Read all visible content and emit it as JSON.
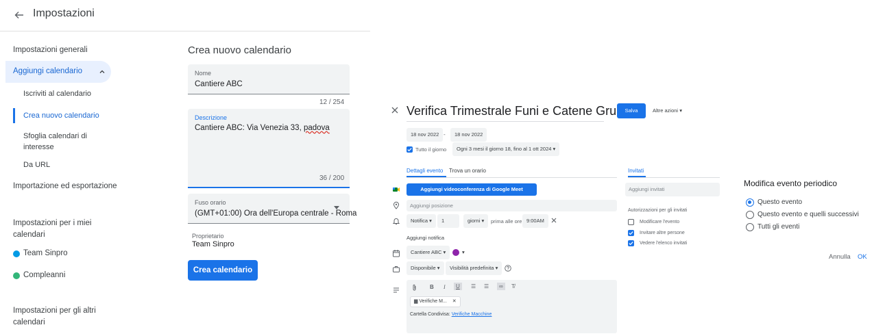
{
  "settings": {
    "back_icon": "arrow-left-icon",
    "title": "Impostazioni",
    "nav": {
      "general": "Impostazioni generali",
      "add_calendar": "Aggiungi calendario",
      "subscribe": "Iscriviti al calendario",
      "create_new": "Crea nuovo calendario",
      "browse_line1": "Sfoglia calendari di",
      "browse_line2": "interesse",
      "from_url": "Da URL",
      "import_export": "Importazione ed esportazione",
      "my_calendars_line1": "Impostazioni per i miei",
      "my_calendars_line2": "calendari",
      "calendars": [
        {
          "name": "Team Sinpro",
          "color": "#039be5"
        },
        {
          "name": "Compleanni",
          "color": "#33b679"
        }
      ],
      "other_calendars_line1": "Impostazioni per gli altri",
      "other_calendars_line2": "calendari"
    }
  },
  "form": {
    "title": "Crea nuovo calendario",
    "name_label": "Nome",
    "name_value": "Cantiere ABC",
    "name_counter": "12 / 254",
    "description_label": "Descrizione",
    "description_value_main": "Cantiere ABC: Via Venezia 33, ",
    "description_value_misspelled": "padova",
    "description_counter": "36 / 200",
    "timezone_label": "Fuso orario",
    "timezone_value": "(GMT+01:00) Ora dell'Europa centrale - Roma",
    "owner_label": "Proprietario",
    "owner_value": "Team Sinpro",
    "create_button": "Crea calendario",
    "accent_color": "#1a73e8"
  },
  "event": {
    "title": "Verifica Trimestrale Funi e Catene Gru",
    "save": "Salva",
    "more_actions": "Altre azioni",
    "start_date": "18 nov 2022",
    "date_separator": "-",
    "end_date": "18 nov 2022",
    "all_day": "Tutto il giorno",
    "recurrence": "Ogni 3 mesi il giorno 18, fino al 1 ott 2024",
    "tabs": [
      "Dettagli evento",
      "Trova un orario"
    ],
    "meet_button": "Aggiungi videoconferenza di Google Meet",
    "location_placeholder": "Aggiungi posizione",
    "notification_type": "Notifica",
    "notification_amount": "1",
    "notification_unit": "giorni",
    "notification_before": "prima alle ore",
    "notification_time": "9:00AM",
    "add_notification": "Aggiungi notifica",
    "calendar": "Cantiere ABC",
    "event_color": "#8e24aa",
    "availability": "Disponibile",
    "visibility": "Visibilità predefinita",
    "attachment": "Verifiche M...",
    "shared_folder_label": "Cartella Condivisa:",
    "shared_folder_link": "Verifiche Macchine",
    "guests_tab": "Invitati",
    "add_guests_placeholder": "Aggiungi invitati",
    "permissions_title": "Autorizzazioni per gli invitati",
    "permissions": [
      {
        "label": "Modificare l'evento",
        "checked": false
      },
      {
        "label": "Invitare altre persone",
        "checked": true
      },
      {
        "label": "Vedere l'elenco invitati",
        "checked": true
      }
    ]
  },
  "dialog": {
    "title": "Modifica evento periodico",
    "options": [
      {
        "label": "Questo evento",
        "selected": true
      },
      {
        "label": "Questo evento e quelli successivi",
        "selected": false
      },
      {
        "label": "Tutti gli eventi",
        "selected": false
      }
    ],
    "cancel": "Annulla",
    "ok": "OK"
  }
}
